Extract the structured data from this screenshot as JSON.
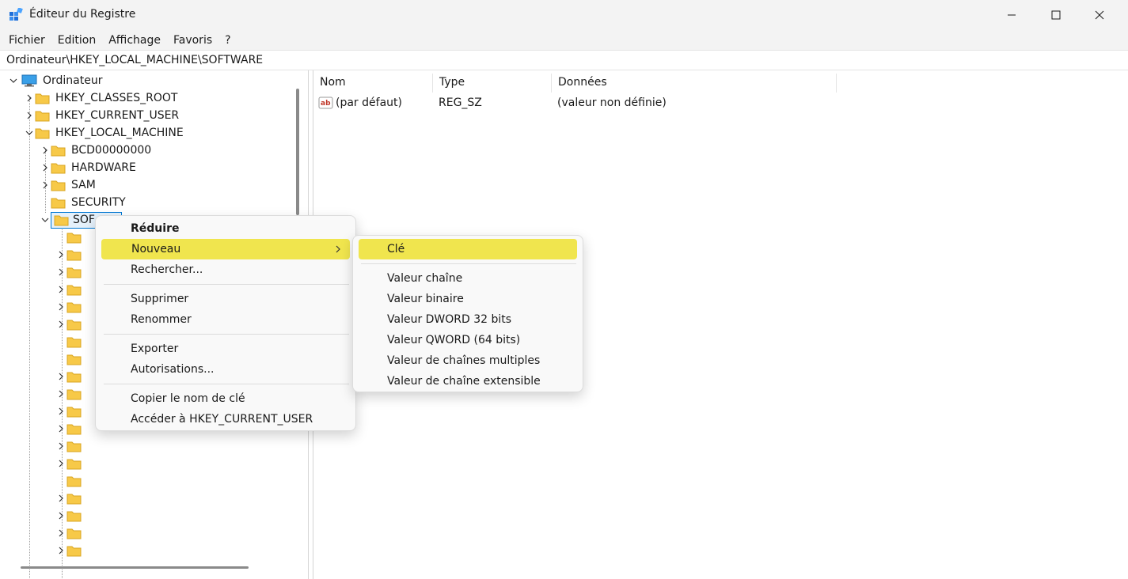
{
  "window": {
    "title": "Éditeur du Registre",
    "icon": "registry-editor-icon",
    "controls": [
      "minimize-icon",
      "maximize-icon",
      "close-icon"
    ]
  },
  "menubar": {
    "items": [
      "Fichier",
      "Edition",
      "Affichage",
      "Favoris",
      "?"
    ]
  },
  "address": {
    "path": "Ordinateur\\HKEY_LOCAL_MACHINE\\SOFTWARE"
  },
  "tree": {
    "root": "Ordinateur",
    "hives": [
      "HKEY_CLASSES_ROOT",
      "HKEY_CURRENT_USER",
      "HKEY_LOCAL_MACHINE"
    ],
    "hklm_children": [
      "BCD00000000",
      "HARDWARE",
      "SAM",
      "SECURITY"
    ],
    "selected": "SOFTWARE",
    "selected_visible": "SOF"
  },
  "list": {
    "columns": [
      "Nom",
      "Type",
      "Données"
    ],
    "rows": [
      {
        "name": "(par défaut)",
        "type": "REG_SZ",
        "data": "(valeur non définie)",
        "icon": "string-value-icon"
      }
    ]
  },
  "context_menu": {
    "items": [
      "Réduire",
      "Nouveau",
      "Rechercher...",
      "Supprimer",
      "Renommer",
      "Exporter",
      "Autorisations...",
      "Copier le nom de clé",
      "Accéder à HKEY_CURRENT_USER"
    ],
    "highlighted": "Nouveau"
  },
  "submenu": {
    "items": [
      "Clé",
      "Valeur chaîne",
      "Valeur binaire",
      "Valeur DWORD 32 bits",
      "Valeur QWORD (64 bits)",
      "Valeur de chaînes multiples",
      "Valeur de chaîne extensible"
    ],
    "highlighted": "Clé"
  },
  "colors": {
    "highlight": "#f0e54e",
    "folder": "#f7c948",
    "selection_border": "#0078d4"
  }
}
